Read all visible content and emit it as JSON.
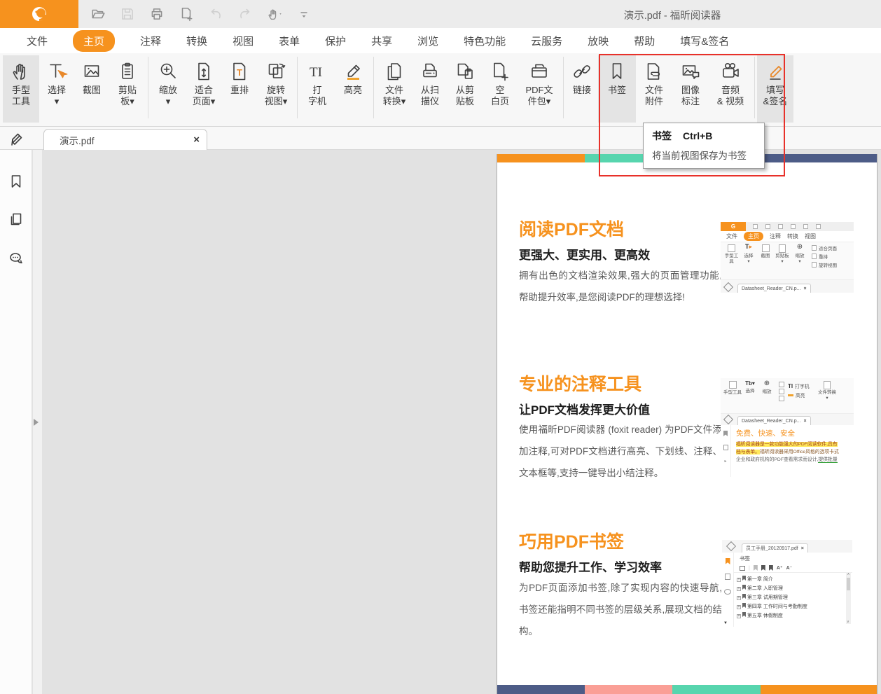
{
  "window": {
    "title": "演示.pdf - 福昕阅读器"
  },
  "quick_access": {
    "icons": [
      "open-folder",
      "save",
      "print",
      "new-page",
      "undo",
      "redo",
      "hand-gesture",
      "customize-toolbar"
    ]
  },
  "menu_tabs": [
    {
      "label": "文件"
    },
    {
      "label": "主页",
      "active": true
    },
    {
      "label": "注释"
    },
    {
      "label": "转换"
    },
    {
      "label": "视图"
    },
    {
      "label": "表单"
    },
    {
      "label": "保护"
    },
    {
      "label": "共享"
    },
    {
      "label": "浏览"
    },
    {
      "label": "特色功能"
    },
    {
      "label": "云服务"
    },
    {
      "label": "放映"
    },
    {
      "label": "帮助"
    },
    {
      "label": "填写&签名"
    }
  ],
  "ribbon": {
    "buttons": [
      {
        "line1": "手型",
        "line2": "工具"
      },
      {
        "line1": "选择",
        "line2": "▾"
      },
      {
        "line1": "截图",
        "line2": ""
      },
      {
        "line1": "剪贴",
        "line2": "板▾"
      },
      {
        "line1": "缩放",
        "line2": "▾"
      },
      {
        "line1": "适合",
        "line2": "页面▾"
      },
      {
        "line1": "重排",
        "line2": ""
      },
      {
        "line1": "旋转",
        "line2": "视图▾"
      },
      {
        "line1": "打",
        "line2": "字机"
      },
      {
        "line1": "高亮",
        "line2": ""
      },
      {
        "line1": "文件",
        "line2": "转换▾"
      },
      {
        "line1": "从扫",
        "line2": "描仪"
      },
      {
        "line1": "从剪",
        "line2": "贴板"
      },
      {
        "line1": "空",
        "line2": "白页"
      },
      {
        "line1": "PDF文",
        "line2": "件包▾"
      },
      {
        "line1": "链接",
        "line2": ""
      },
      {
        "line1": "书签",
        "line2": ""
      },
      {
        "line1": "文件",
        "line2": "附件"
      },
      {
        "line1": "图像",
        "line2": "标注"
      },
      {
        "line1": "音频",
        "line2": "& 视频"
      },
      {
        "line1": "填写",
        "line2": "&签名"
      }
    ]
  },
  "tooltip": {
    "title": "书签",
    "shortcut": "Ctrl+B",
    "description": "将当前视图保存为书签"
  },
  "doc_tab": {
    "label": "演示.pdf",
    "close": "×"
  },
  "sidebar": {
    "icons": [
      "pencil",
      "bookmark",
      "pages",
      "comments"
    ]
  },
  "colors": {
    "accent_orange": "#F6921E",
    "teal": "#57D5AE",
    "salmon": "#FA9F96",
    "navy": "#4D5C87",
    "red_highlight": "#E8312A"
  },
  "page": {
    "top_bar_colors": [
      "#F6921E",
      "#57D5AE",
      "#FA9F96",
      "#4D5C87"
    ],
    "bottom_bar_colors": [
      "#4D5C87",
      "#FA9F96",
      "#57D5AE",
      "#F6921E"
    ],
    "sections": [
      {
        "title": "阅读PDF文档",
        "subtitle": "更强大、更实用、更高效",
        "body": "拥有出色的文档渲染效果,强大的页面管理功能,帮助提升效率,是您阅读PDF的理想选择!"
      },
      {
        "title": "专业的注释工具",
        "subtitle": "让PDF文档发挥更大价值",
        "body": "使用福昕PDF阅读器 (foxit reader) 为PDF文件添加注释,可对PDF文档进行高亮、下划线、注释、文本框等,支持一键导出小结注释。"
      },
      {
        "title": "巧用PDF书签",
        "subtitle": "帮助您提升工作、学习效率",
        "body": "为PDF页面添加书签,除了实现内容的快速导航,书签还能指明不同书签的层级关系,展现文档的结构。"
      }
    ]
  },
  "thumb1": {
    "logo": "G",
    "tabs": [
      "文件",
      "主页",
      "注释",
      "转换",
      "视图"
    ],
    "tools": [
      "手型工具",
      "选择",
      "截图",
      "剪贴板",
      "缩放"
    ],
    "side_tools": [
      "适合页面",
      "重排",
      "旋转视图"
    ],
    "doc_tab": "Datasheet_Reader_CN.p...",
    "close": "×"
  },
  "thumb2": {
    "tools": [
      "手型工具",
      "选择",
      "缩放",
      "打字机",
      "高亮",
      "文件转换"
    ],
    "doc_tab": "Datasheet_Reader_CN.p...",
    "close": "×",
    "heading": "免费、快速、安全",
    "line1": "福昕阅读器是一款功能强大的PDF阅读软件,具有",
    "line2a": "档与表单。",
    "line2b": "福昕阅读器采用Office风格的选项卡式",
    "line3a": "企业和政府机构的PDF查看需求而设计,",
    "line3b": "提供批量"
  },
  "thumb3": {
    "doc_tab": "员工手册_20120917.pdf",
    "close": "×",
    "panel_title": "书签",
    "items": [
      "第一章 简介",
      "第二章 入职管理",
      "第三章 试用期管理",
      "第四章 工作时间与考勤制度",
      "第五章 休假制度"
    ]
  }
}
